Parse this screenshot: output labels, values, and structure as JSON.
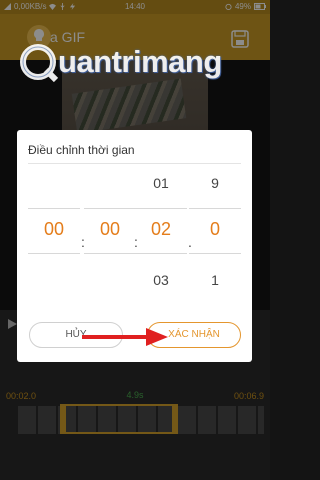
{
  "status_bar": {
    "network": "0,00KB/s",
    "time": "14:40",
    "battery": "49%"
  },
  "app_bar": {
    "title": "a GIF",
    "icons": [
      "lightbulb-icon",
      "save-icon"
    ]
  },
  "watermark": {
    "text": "uantrimang"
  },
  "timeline": {
    "start_time": "00:02.0",
    "duration": "4.9s",
    "end_time": "00:06.9"
  },
  "dialog": {
    "title": "Điều chỉnh thời gian",
    "columns": [
      {
        "above": "",
        "value": "00",
        "below": ""
      },
      {
        "above": "",
        "value": "00",
        "below": ""
      },
      {
        "above": "01",
        "value": "02",
        "below": "03"
      },
      {
        "above": "9",
        "value": "0",
        "below": "1"
      }
    ],
    "separators": [
      ":",
      ":",
      "."
    ],
    "cancel_label": "HỦY",
    "confirm_label": "XÁC NHẬN"
  },
  "colors": {
    "accent": "#e47d1b",
    "app_bar": "#c89a25",
    "arrow": "#e02020"
  }
}
